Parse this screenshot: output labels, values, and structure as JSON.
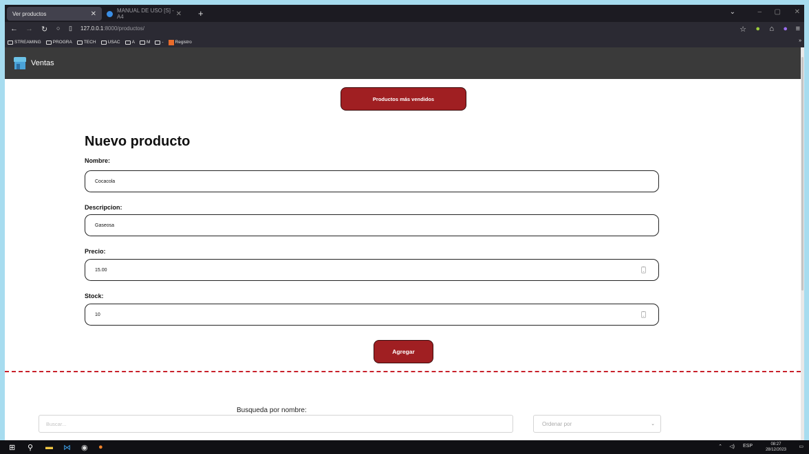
{
  "browser": {
    "tabs": [
      {
        "label": "Ver productos",
        "active": true
      },
      {
        "label": "MANUAL DE USO [S] - A4",
        "active": false
      }
    ],
    "new_tab": "+",
    "url_host": "127.0.0.1",
    "url_rest": ":8000/productos/",
    "bookmarks": [
      "STREAMING",
      "PROGRA",
      "TECH",
      "USAC",
      "A",
      "M",
      "-",
      "Registro"
    ],
    "bookmarks_overflow": "»"
  },
  "app": {
    "brand": "Ventas"
  },
  "page": {
    "top_button": "Productos más vendidos",
    "title": "Nuevo producto",
    "fields": {
      "nombre_label": "Nombre:",
      "nombre_value": "Cocacola",
      "descripcion_label": "Descripcion:",
      "descripcion_value": "Gaseosa",
      "precio_label": "Precio:",
      "precio_value": "15.00",
      "stock_label": "Stock:",
      "stock_value": "10"
    },
    "add_button": "Agregar",
    "search_label": "Busqueda por nombre:",
    "search_placeholder": "Buscar...",
    "order_placeholder": "Ordenar por"
  },
  "taskbar": {
    "lang": "ESP",
    "time": "08:27",
    "date": "28/12/2023"
  },
  "colors": {
    "accent": "#a01f22",
    "divider": "#c8202a",
    "header": "#3a3a3a"
  }
}
